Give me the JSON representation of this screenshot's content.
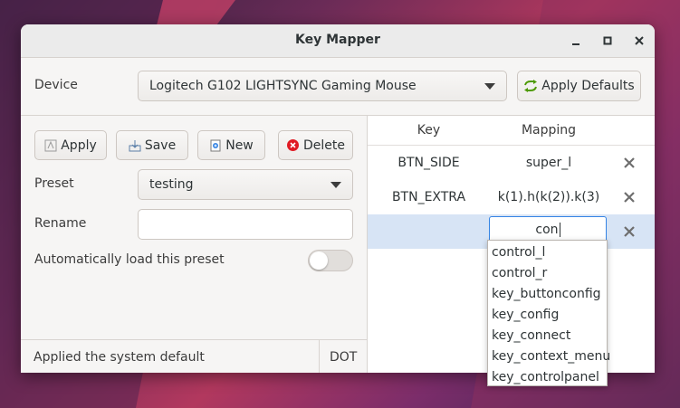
{
  "window": {
    "title": "Key Mapper"
  },
  "device": {
    "label": "Device",
    "selected": "Logitech G102 LIGHTSYNC Gaming Mouse",
    "apply_defaults_label": "Apply Defaults"
  },
  "toolbar": {
    "apply_label": "Apply",
    "save_label": "Save",
    "new_label": "New",
    "delete_label": "Delete"
  },
  "preset": {
    "label": "Preset",
    "selected": "testing"
  },
  "rename": {
    "label": "Rename",
    "value": ""
  },
  "autoload": {
    "label": "Automatically load this preset",
    "enabled": false
  },
  "status": {
    "message": "Applied the system default",
    "mode": "DOT"
  },
  "mapping_table": {
    "headers": {
      "key": "Key",
      "mapping": "Mapping"
    },
    "rows": [
      {
        "key": "BTN_SIDE",
        "mapping": "super_l"
      },
      {
        "key": "BTN_EXTRA",
        "mapping": "k(1).h(k(2)).k(3)"
      },
      {
        "key": "",
        "mapping": "con"
      }
    ]
  },
  "autocomplete": {
    "items": [
      "control_l",
      "control_r",
      "key_buttonconfig",
      "key_config",
      "key_connect",
      "key_context_menu",
      "key_controlpanel"
    ]
  },
  "colors": {
    "selected_row": "#d7e4f5",
    "focus_border": "#3584e4",
    "apply_defaults_icon": "#4e9a06"
  }
}
